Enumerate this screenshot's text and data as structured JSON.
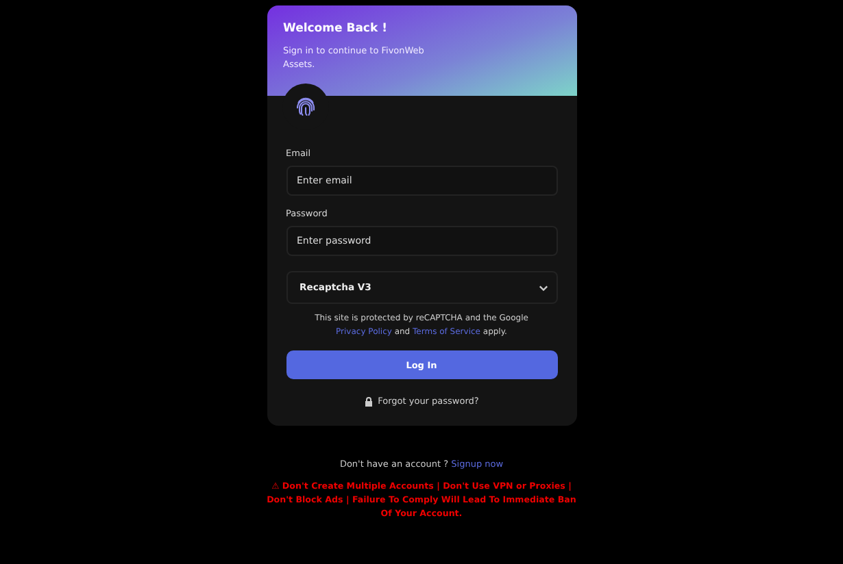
{
  "header": {
    "title": "Welcome Back !",
    "subtitle": "Sign in to continue to FivonWeb Assets."
  },
  "fields": [
    {
      "label": "Email",
      "placeholder": "Enter email"
    },
    {
      "label": "Password",
      "placeholder": "Enter password"
    }
  ],
  "captcha_select": {
    "value": "Recaptcha V3"
  },
  "notice": {
    "before": "This site is protected by reCAPTCHA and the Google",
    "privacy_link": "Privacy Policy",
    "middle": "and",
    "terms_link": "Terms of Service",
    "after": "apply."
  },
  "login_button": "Log In",
  "forgot_link": "Forgot your password?",
  "signup": {
    "text": "Don't have an account ?",
    "link": "Signup now"
  },
  "warning": "⚠ Don't Create Multiple Accounts | Don't Use VPN or Proxies | Don't Block Ads | Failure To Comply Will Lead To Immediate Ban Of Your Account."
}
